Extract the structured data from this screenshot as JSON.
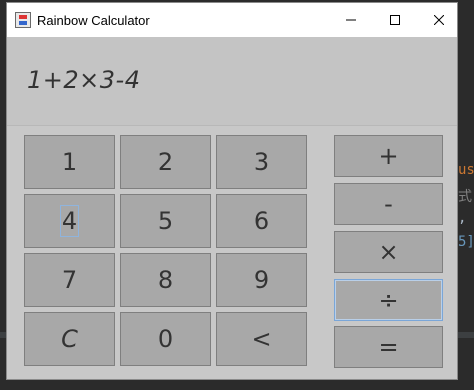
{
  "window": {
    "title": "Rainbow Calculator",
    "min_label": "minimize",
    "max_label": "maximize",
    "close_label": "close"
  },
  "display": {
    "expression": "1+2×3-4"
  },
  "keypad": {
    "r1": [
      "1",
      "2",
      "3"
    ],
    "r2": [
      "4",
      "5",
      "6"
    ],
    "r3": [
      "7",
      "8",
      "9"
    ],
    "r4": [
      "C",
      "0",
      "<"
    ]
  },
  "operators": [
    "+",
    "-",
    "×",
    "÷",
    "="
  ],
  "background": {
    "frag_use": "use",
    "frag_chars": "式.",
    "frag_comma": ",",
    "frag_5": "5]"
  },
  "icons": {
    "app": "calculator-app-icon",
    "minimize": "minimize-icon",
    "maximize": "maximize-icon",
    "close": "close-icon"
  },
  "colors": {
    "titlebar": "#ffffff",
    "body": "#c8c8c8",
    "button": "#a8a8a8",
    "focus": "#7aa6d8"
  }
}
